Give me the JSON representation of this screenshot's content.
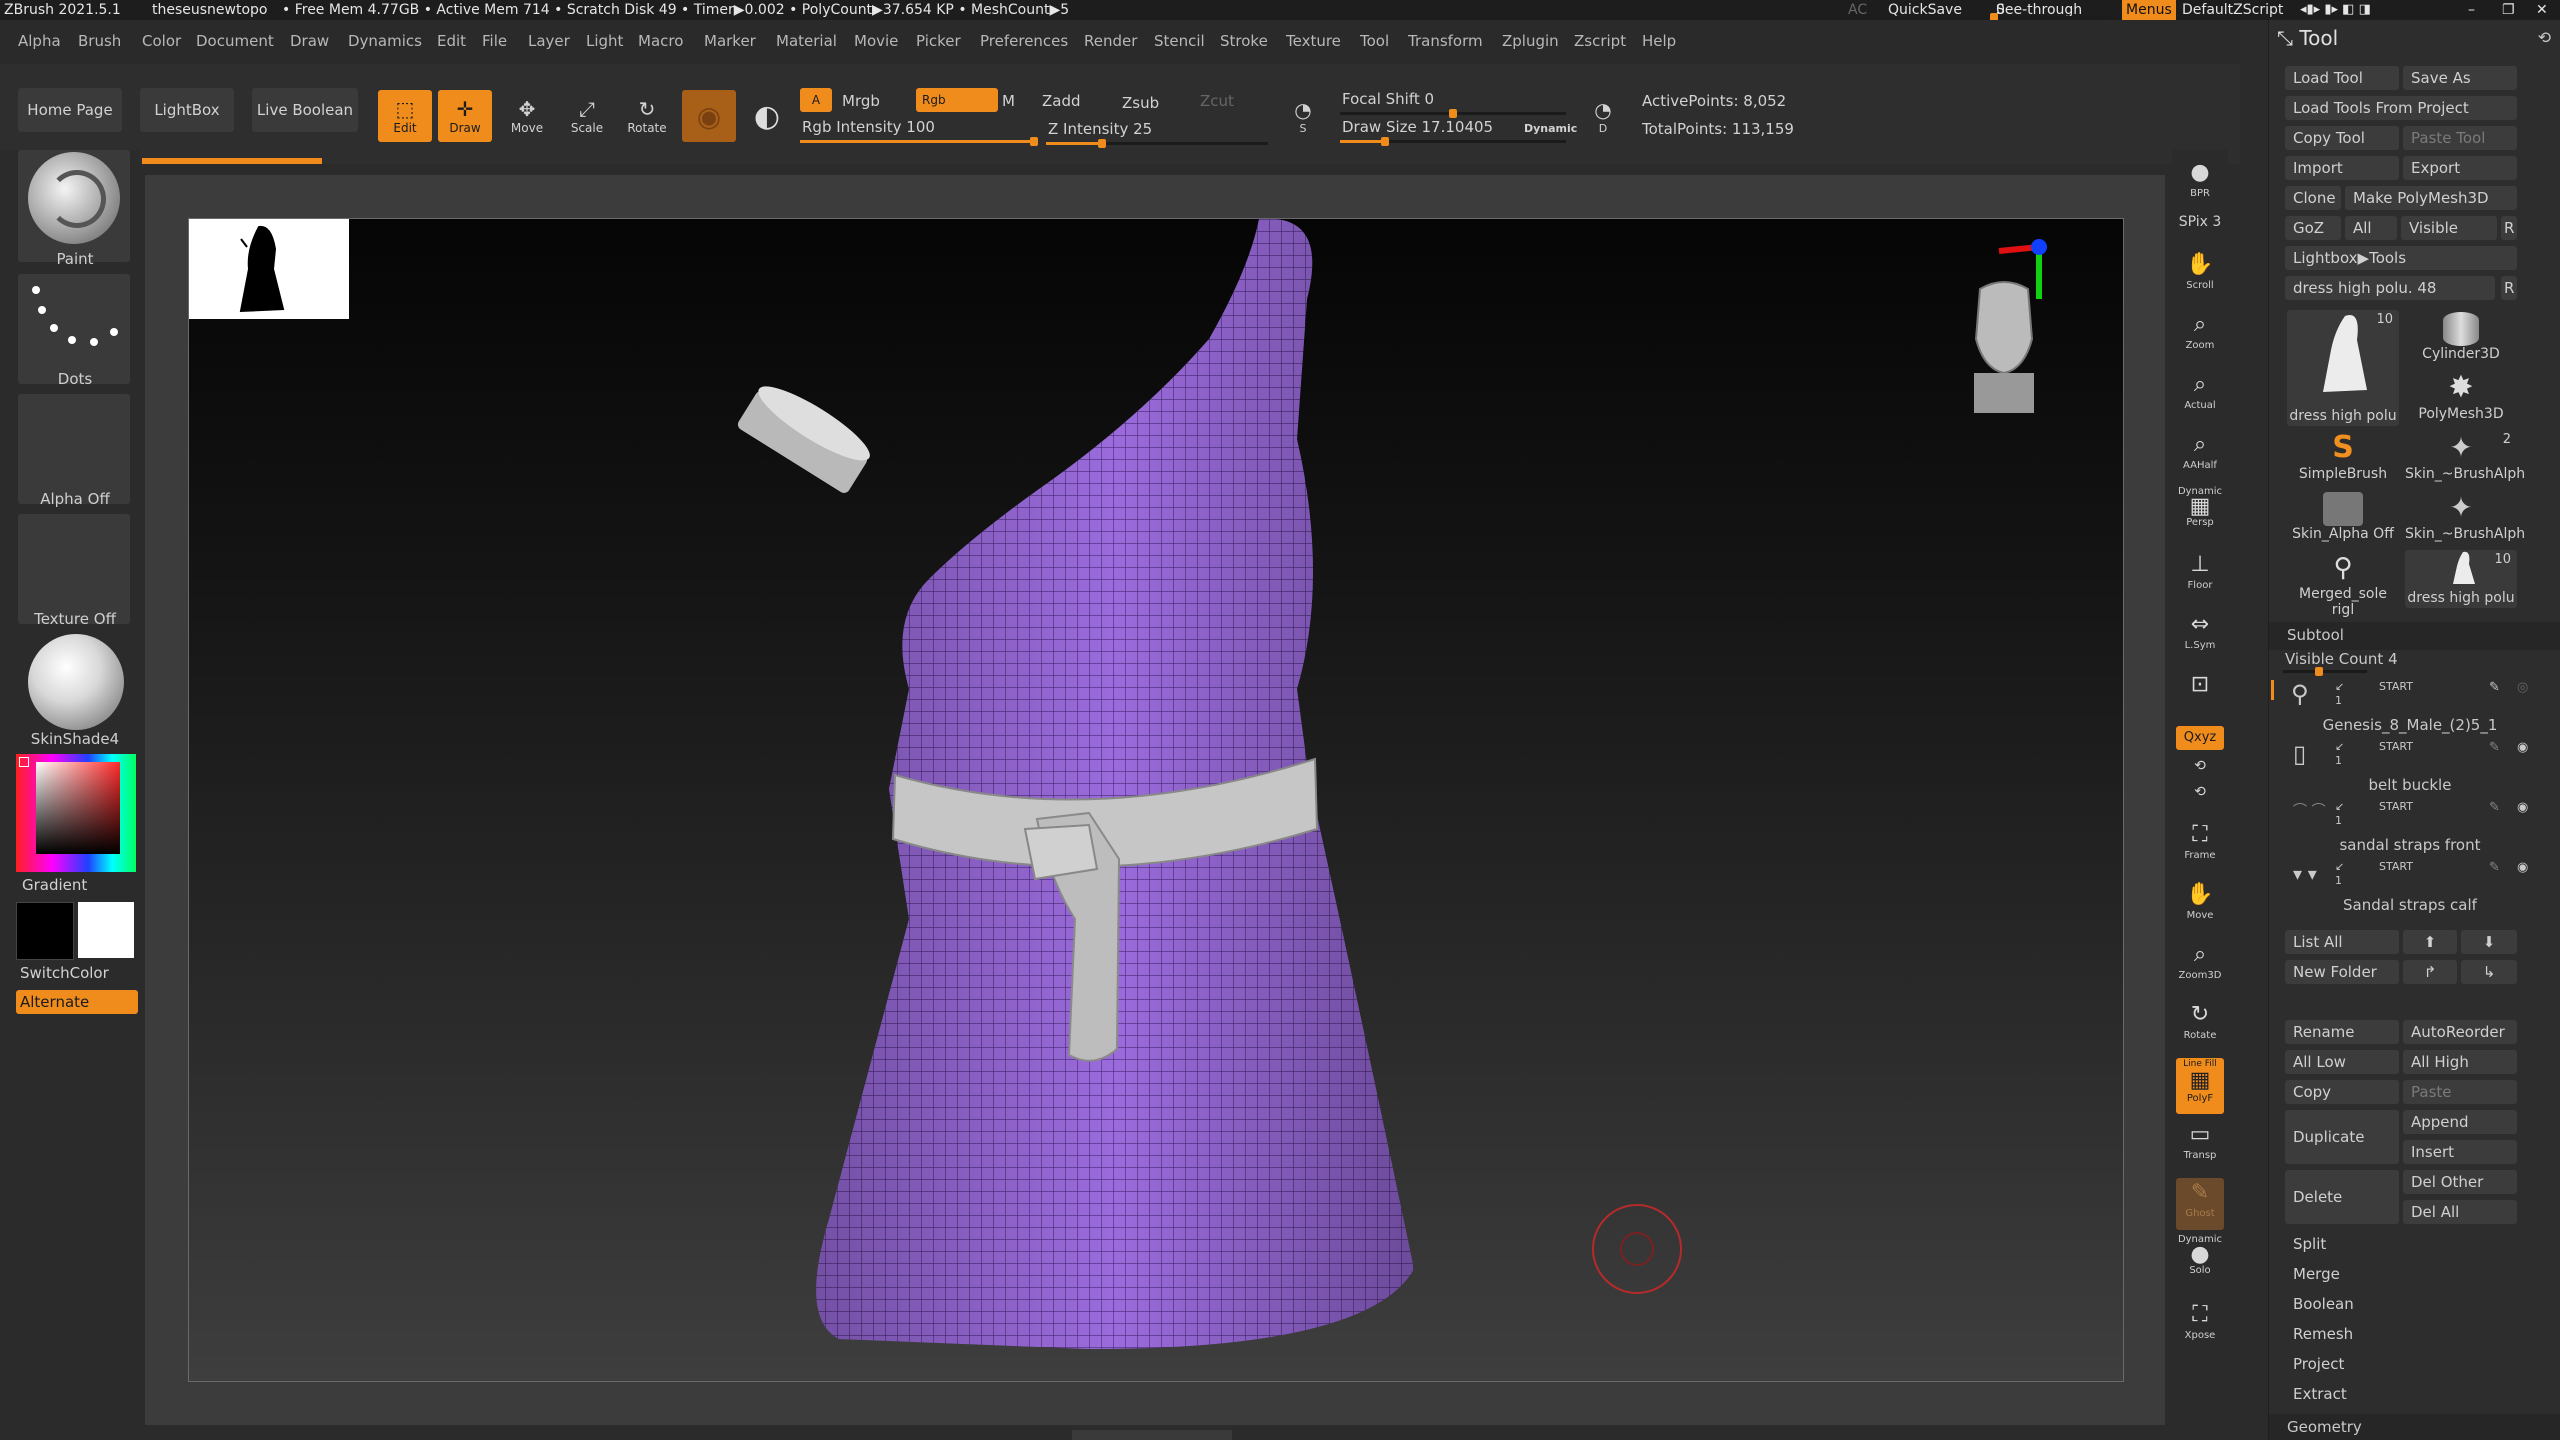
{
  "titlebar": {
    "app": "ZBrush 2021.5.1",
    "user": "theseusnewtopo",
    "status": "• Free Mem 4.77GB • Active Mem 714 • Scratch Disk 49 • Timer▶0.002 • PolyCount▶37.654 KP • MeshCount▶5",
    "ac": "AC",
    "quicksave": "QuickSave",
    "seethrough": "See-through",
    "seethrough_value": "0",
    "menus": "Menus",
    "defaultzscript": "DefaultZScript"
  },
  "menu": [
    "Alpha",
    "Brush",
    "Color",
    "Document",
    "Draw",
    "Dynamics",
    "Edit",
    "File",
    "Layer",
    "Light",
    "Macro",
    "Marker",
    "Material",
    "Movie",
    "Picker",
    "Preferences",
    "Render",
    "Stencil",
    "Stroke",
    "Texture",
    "Tool",
    "Transform",
    "Zplugin",
    "Zscript",
    "Help"
  ],
  "shelf": {
    "home": "Home Page",
    "lightbox": "LightBox",
    "liveboolean": "Live Boolean",
    "edit": "Edit",
    "draw": "Draw",
    "move": "Move",
    "scale": "Scale",
    "rotate": "Rotate",
    "a": "A",
    "mrgb": "Mrgb",
    "rgb": "Rgb",
    "m": "M",
    "zadd": "Zadd",
    "zsub": "Zsub",
    "zcut": "Zcut",
    "rgb_intensity": "Rgb Intensity 100",
    "z_intensity": "Z Intensity 25",
    "focal_shift": "Focal Shift 0",
    "draw_size": "Draw Size 17.10405",
    "dynamic": "Dynamic",
    "active_points": "ActivePoints: 8,052",
    "total_points": "TotalPoints: 113,159",
    "s": "S",
    "d": "D"
  },
  "sliders": {
    "rgb_intensity": 1.0,
    "z_intensity": 0.25,
    "focal_shift": 0.5,
    "draw_size": 0.2,
    "seethrough": 0.0
  },
  "left": {
    "paint": "Paint",
    "dots": "Dots",
    "alpha_off": "Alpha Off",
    "texture_off": "Texture Off",
    "material": "SkinShade4",
    "gradient": "Gradient",
    "switchcolor": "SwitchColor",
    "alternate": "Alternate"
  },
  "right": {
    "bpr": "BPR",
    "spix": "SPix 3",
    "scroll": "Scroll",
    "zoom": "Zoom",
    "actual": "Actual",
    "aahalf": "AAHalf",
    "dynamic": "Dynamic",
    "persp": "Persp",
    "floor": "Floor",
    "lsym": "L.Sym",
    "xyz": "Qxyz",
    "frame": "Frame",
    "move": "Move",
    "zoom3d": "Zoom3D",
    "rotate": "Rotate",
    "linefill": "Line Fill",
    "polyf": "PolyF",
    "transp": "Transp",
    "ghost": "Ghost",
    "solo_dynamic": "Dynamic",
    "solo": "Solo",
    "xpose": "Xpose"
  },
  "tool": {
    "header": "Tool",
    "load_tool": "Load Tool",
    "save_as": "Save As",
    "load_from_project": "Load Tools From Project",
    "copy_tool": "Copy Tool",
    "paste_tool": "Paste Tool",
    "import": "Import",
    "export": "Export",
    "clone": "Clone",
    "make_polymesh": "Make PolyMesh3D",
    "goz": "GoZ",
    "all": "All",
    "visible": "Visible",
    "r": "R",
    "lightbox_tools": "Lightbox▶Tools",
    "current_tool": "dress high polu. 48",
    "thumbs": [
      {
        "label": "dress high polu",
        "badge": "10"
      },
      {
        "label": "Cylinder3D",
        "badge": ""
      },
      {
        "label": "PolyMesh3D",
        "badge": ""
      },
      {
        "label": "SimpleBrush",
        "badge": ""
      },
      {
        "label": "Skin_~BrushAlph",
        "badge": "2"
      },
      {
        "label": "Skin_Alpha Off",
        "badge": ""
      },
      {
        "label": "Skin_~BrushAlph",
        "badge": ""
      },
      {
        "label": "Merged_sole rigl",
        "badge": ""
      },
      {
        "label": "dress high polu",
        "badge": "10"
      }
    ]
  },
  "subtool": {
    "title": "Subtool",
    "visible_count": "Visible Count 4",
    "items": [
      {
        "name": "Genesis_8_Male_(2)5_1",
        "start": "START",
        "num": "1"
      },
      {
        "name": "belt buckle",
        "start": "START",
        "num": "1"
      },
      {
        "name": "sandal straps front",
        "start": "START",
        "num": "1"
      },
      {
        "name": "Sandal straps calf",
        "start": "START",
        "num": "1"
      }
    ],
    "list_all": "List All",
    "new_folder": "New Folder",
    "rename": "Rename",
    "autoreorder": "AutoReorder",
    "all_low": "All Low",
    "all_high": "All High",
    "copy": "Copy",
    "paste": "Paste",
    "duplicate": "Duplicate",
    "append": "Append",
    "insert": "Insert",
    "delete": "Delete",
    "del_other": "Del Other",
    "del_all": "Del All",
    "split": "Split",
    "merge": "Merge",
    "boolean": "Boolean",
    "remesh": "Remesh",
    "project": "Project",
    "extract": "Extract",
    "geometry": "Geometry"
  },
  "colors": {
    "accent": "#f08c1c",
    "mesh": "#9966dd",
    "belt": "#c8c8c8"
  }
}
